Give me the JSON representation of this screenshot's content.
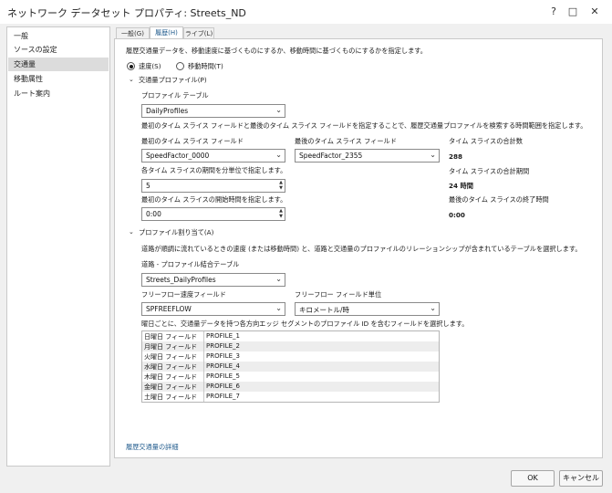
{
  "window": {
    "title": "ネットワーク データセット プロパティ: Streets_ND",
    "help_icon": "?",
    "maximize_icon": "□",
    "close_icon": "✕"
  },
  "sidebar": {
    "items": [
      {
        "label": "一般",
        "selected": false
      },
      {
        "label": "ソースの設定",
        "selected": false
      },
      {
        "label": "交通量",
        "selected": true
      },
      {
        "label": "移動属性",
        "selected": false
      },
      {
        "label": "ルート案内",
        "selected": false
      }
    ]
  },
  "tabs": [
    {
      "label": "一般(G)",
      "active": false
    },
    {
      "label": "履歴(H)",
      "active": true
    },
    {
      "label": "ライブ(L)",
      "active": false
    }
  ],
  "history": {
    "intro": "履歴交通量データを、移動速度に基づくものにするか、移動時間に基づくものにするかを指定します。",
    "radio_speed": "速度(S)",
    "radio_time": "移動時間(T)",
    "profile_section": "交通量プロファイル(P)",
    "profile_table_label": "プロファイル テーブル",
    "profile_table_value": "DailyProfiles",
    "slice_help": "最初のタイム スライス フィールドと最後のタイム スライス フィールドを指定することで、履歴交通量プロファイルを検索する時間範囲を指定します。",
    "first_slice_label": "最初のタイム スライス フィールド",
    "first_slice_value": "SpeedFactor_0000",
    "last_slice_label": "最後のタイム スライス フィールド",
    "last_slice_value": "SpeedFactor_2355",
    "total_slices_label": "タイム スライスの合計数",
    "total_slices_value": "288",
    "period_help": "各タイム スライスの期間を分単位で指定します。",
    "period_value": "5",
    "total_duration_label": "タイム スライスの合計期間",
    "total_duration_value": "24 時間",
    "start_help": "最初のタイム スライスの開始時間を指定します。",
    "start_value": "0:00",
    "end_label": "最後のタイム スライスの終了時間",
    "end_value": "0:00",
    "assign_section": "プロファイル割り当て(A)",
    "assign_help": "道路が順調に流れているときの速度 (または移動時間) と、道路と交通量のプロファイルのリレーションシップが含まれているテーブルを選択します。",
    "join_table_label": "道路 - プロファイル結合テーブル",
    "join_table_value": "Streets_DailyProfiles",
    "freeflow_label": "フリーフロー速度フィールド",
    "freeflow_value": "SPFREEFLOW",
    "freeflow_unit_label": "フリーフロー フィールド単位",
    "freeflow_unit_value": "キロメートル/時",
    "weekday_help": "曜日ごとに、交通量データを持つ各方向エッジ セグメントのプロファイル ID を含むフィールドを選択します。",
    "weekday_rows": [
      {
        "day": "日曜日 フィールド",
        "field": "PROFILE_1"
      },
      {
        "day": "月曜日 フィールド",
        "field": "PROFILE_2"
      },
      {
        "day": "火曜日 フィールド",
        "field": "PROFILE_3"
      },
      {
        "day": "水曜日 フィールド",
        "field": "PROFILE_4"
      },
      {
        "day": "木曜日 フィールド",
        "field": "PROFILE_5"
      },
      {
        "day": "金曜日 フィールド",
        "field": "PROFILE_6"
      },
      {
        "day": "土曜日 フィールド",
        "field": "PROFILE_7"
      }
    ],
    "details_link": "履歴交通量の詳細"
  },
  "footer": {
    "ok": "OK",
    "cancel": "キャンセル"
  }
}
